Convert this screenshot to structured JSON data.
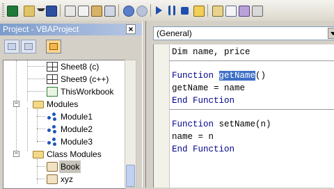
{
  "toolbar": {
    "icons": [
      "excel-icon",
      "insert-object-icon",
      "save-icon",
      "cut-icon",
      "copy-icon",
      "paste-icon",
      "find-icon",
      "undo-icon",
      "redo-icon",
      "run-icon",
      "break-icon",
      "reset-icon",
      "design-mode-icon",
      "project-explorer-icon",
      "properties-icon",
      "object-browser-icon",
      "toolbox-icon"
    ]
  },
  "project": {
    "title": "Project - VBAProject",
    "close_glyph": "×",
    "tree": [
      {
        "label": "Sheet8 (c)",
        "icon": "sheet-icon"
      },
      {
        "label": "Sheet9 (c++)",
        "icon": "sheet-icon"
      },
      {
        "label": "ThisWorkbook",
        "icon": "workbook-icon"
      },
      {
        "label": "Modules",
        "icon": "folder-icon",
        "expander": "−"
      },
      {
        "label": "Module1",
        "icon": "module-icon"
      },
      {
        "label": "Module2",
        "icon": "module-icon"
      },
      {
        "label": "Module3",
        "icon": "module-icon"
      },
      {
        "label": "Class Modules",
        "icon": "folder-icon",
        "expander": "−"
      },
      {
        "label": "Book",
        "icon": "class-module-icon",
        "selected": true
      },
      {
        "label": "xyz",
        "icon": "class-module-icon"
      }
    ]
  },
  "code": {
    "object_combo": "(General)",
    "lines": {
      "l1": "Dim name, price",
      "l2_kw": "Function ",
      "l2_hl": "getName",
      "l2_rest": "()",
      "l3": "getName = name",
      "l4": "End Function",
      "l5_kw": "Function ",
      "l5_rest": "setName(n)",
      "l6": "name = n",
      "l7": "End Function"
    }
  },
  "colors": {
    "selection": "#3d6fc6",
    "keyword": "#00008b",
    "title_bar": "#7c9ccb"
  }
}
